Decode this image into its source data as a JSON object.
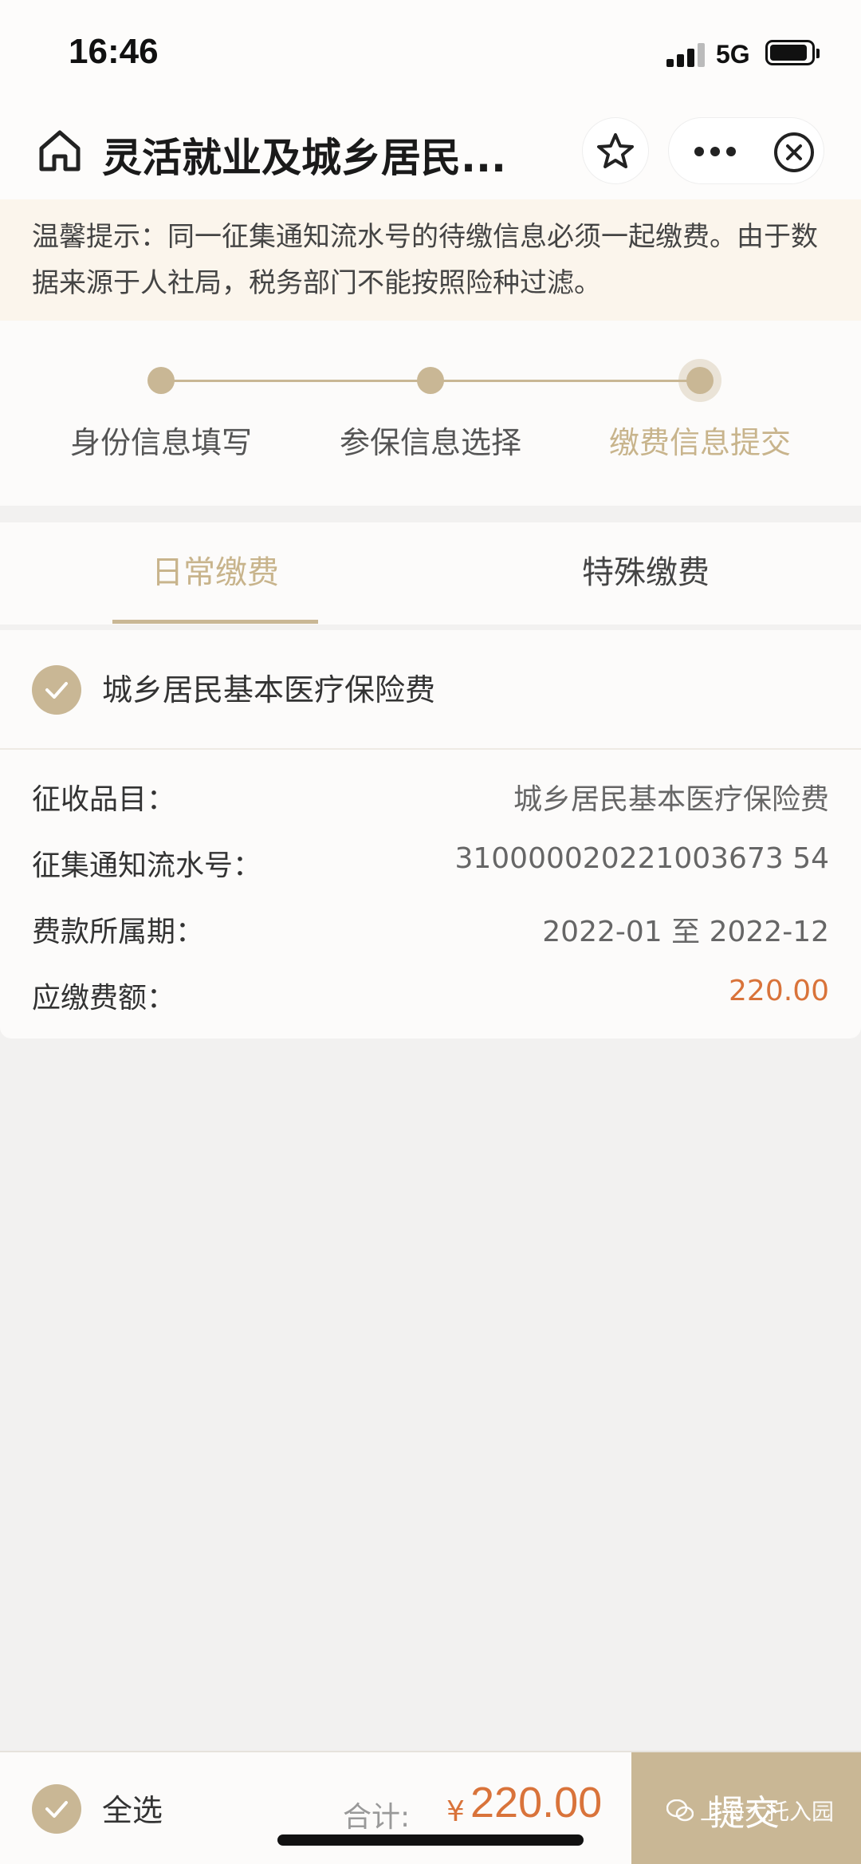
{
  "status_bar": {
    "time": "16:46",
    "network": "5G"
  },
  "nav": {
    "title": "灵活就业及城乡居民..."
  },
  "notice": {
    "text": "温馨提示：同一征集通知流水号的待缴信息必须一起缴费。由于数据来源于人社局，税务部门不能按照险种过滤。"
  },
  "steps": [
    {
      "label": "身份信息填写"
    },
    {
      "label": "参保信息选择"
    },
    {
      "label": "缴费信息提交"
    }
  ],
  "tabs": [
    {
      "label": "日常缴费"
    },
    {
      "label": "特殊缴费"
    }
  ],
  "item": {
    "name": "城乡居民基本医疗保险费",
    "details": [
      {
        "label": "征收品目：",
        "value": "城乡居民基本医疗保险费"
      },
      {
        "label": "征集通知流水号：",
        "value": "310000020221003673 54"
      },
      {
        "label": "费款所属期：",
        "value": "2022-01 至 2022-12"
      },
      {
        "label": "应缴费额：",
        "value": "220.00"
      }
    ]
  },
  "bottom": {
    "select_all": "全选",
    "total_label": "合计:",
    "currency": "¥",
    "total_amount": "220.00",
    "submit": "提交",
    "watermark": "上海大托入园"
  },
  "colors": {
    "accent": "#c9b795",
    "amount": "#d9733a",
    "notice_bg": "#fbf5ec"
  }
}
